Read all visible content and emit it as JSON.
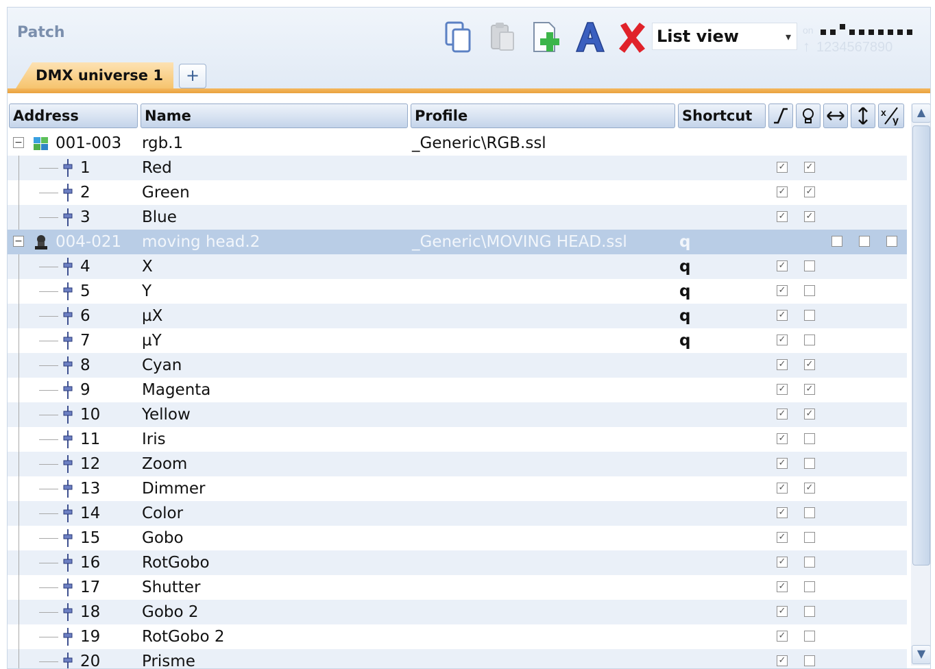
{
  "panel": {
    "title": "Patch"
  },
  "toolbar": {
    "view_mode": "List view",
    "dmx_meter": {
      "label_on": "on",
      "digits": "1234567890"
    }
  },
  "tabs": {
    "active": "DMX universe 1",
    "add": "+"
  },
  "columns": {
    "address": "Address",
    "name": "Name",
    "profile": "Profile",
    "shortcut": "Shortcut"
  },
  "fixtures": [
    {
      "address": "001-003",
      "name": "rgb.1",
      "profile": "_Generic\\RGB.ssl",
      "shortcut": "",
      "channels": [
        {
          "num": "1",
          "name": "Red",
          "shortcut": "",
          "fade": true,
          "highlight": true
        },
        {
          "num": "2",
          "name": "Green",
          "shortcut": "",
          "fade": true,
          "highlight": true
        },
        {
          "num": "3",
          "name": "Blue",
          "shortcut": "",
          "fade": true,
          "highlight": true
        }
      ]
    },
    {
      "address": "004-021",
      "name": "moving head.2",
      "profile": "_Generic\\MOVING HEAD.ssl",
      "shortcut": "q",
      "invert_x": false,
      "invert_y": false,
      "swap_xy": false,
      "channels": [
        {
          "num": "4",
          "name": "X",
          "shortcut": "q",
          "fade": true,
          "highlight": false
        },
        {
          "num": "5",
          "name": "Y",
          "shortcut": "q",
          "fade": true,
          "highlight": false
        },
        {
          "num": "6",
          "name": "µX",
          "shortcut": "q",
          "fade": true,
          "highlight": false
        },
        {
          "num": "7",
          "name": "µY",
          "shortcut": "q",
          "fade": true,
          "highlight": false
        },
        {
          "num": "8",
          "name": "Cyan",
          "shortcut": "",
          "fade": true,
          "highlight": true
        },
        {
          "num": "9",
          "name": "Magenta",
          "shortcut": "",
          "fade": true,
          "highlight": true
        },
        {
          "num": "10",
          "name": "Yellow",
          "shortcut": "",
          "fade": true,
          "highlight": true
        },
        {
          "num": "11",
          "name": "Iris",
          "shortcut": "",
          "fade": true,
          "highlight": false
        },
        {
          "num": "12",
          "name": "Zoom",
          "shortcut": "",
          "fade": true,
          "highlight": false
        },
        {
          "num": "13",
          "name": "Dimmer",
          "shortcut": "",
          "fade": true,
          "highlight": true
        },
        {
          "num": "14",
          "name": "Color",
          "shortcut": "",
          "fade": true,
          "highlight": false
        },
        {
          "num": "15",
          "name": "Gobo",
          "shortcut": "",
          "fade": true,
          "highlight": false
        },
        {
          "num": "16",
          "name": "RotGobo",
          "shortcut": "",
          "fade": true,
          "highlight": false
        },
        {
          "num": "17",
          "name": "Shutter",
          "shortcut": "",
          "fade": true,
          "highlight": false
        },
        {
          "num": "18",
          "name": "Gobo 2",
          "shortcut": "",
          "fade": true,
          "highlight": false
        },
        {
          "num": "19",
          "name": "RotGobo 2",
          "shortcut": "",
          "fade": true,
          "highlight": false
        },
        {
          "num": "20",
          "name": "Prisme",
          "shortcut": "",
          "fade": true,
          "highlight": false
        }
      ]
    }
  ],
  "colors": {
    "accent_orange": "#f6c46e",
    "header_blue": "#c4d4ea",
    "selected_row": "#b9cde6",
    "delete_red": "#e0222a",
    "add_green": "#3bb54a",
    "text_tool_blue": "#3a5fbf"
  }
}
